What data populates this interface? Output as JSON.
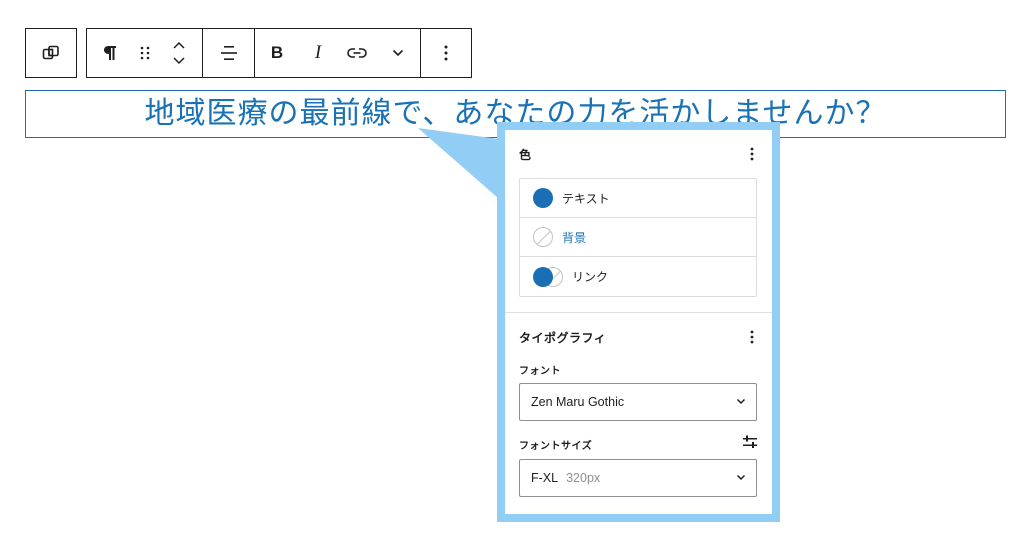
{
  "toolbar": {
    "transform_icon": "block-transform-icon",
    "paragraph_icon": "pilcrow-icon",
    "drag_icon": "drag-handle-icon",
    "move_icon": "move-up-down-icon",
    "align_icon": "align-center-icon",
    "bold_label": "B",
    "italic_label": "I",
    "link_icon": "link-icon",
    "more_format_icon": "chevron-down-icon",
    "options_icon": "more-vertical-icon"
  },
  "heading": {
    "text": "地域医療の最前線で、あなたの力を活かしませんか？",
    "color": "#1a72b5"
  },
  "panel": {
    "color_section": {
      "title": "色",
      "items": [
        {
          "label": "テキスト",
          "swatch": "#1a6fb4"
        },
        {
          "label": "背景",
          "swatch": "none"
        },
        {
          "label": "リンク",
          "swatch": "#1a6fb4"
        }
      ]
    },
    "typography_section": {
      "title": "タイポグラフィ",
      "font_label": "フォント",
      "font_value": "Zen Maru Gothic",
      "size_label": "フォントサイズ",
      "size_value": "F-XL",
      "size_sub": "320px"
    }
  },
  "colors": {
    "accent": "#1a72b5",
    "callout_frame": "#92cdf5"
  }
}
